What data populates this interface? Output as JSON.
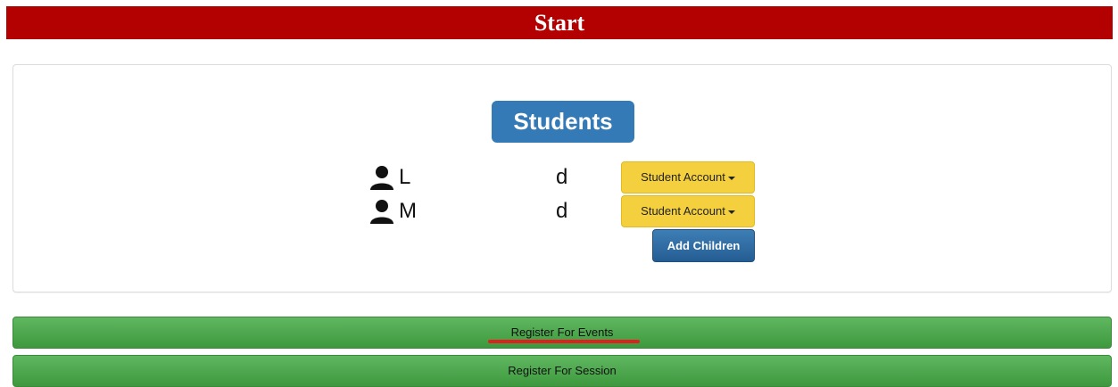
{
  "header": {
    "title": "Start"
  },
  "students_panel": {
    "title": "Students",
    "students": [
      {
        "name_visible_start": "L",
        "name_visible_end": "d",
        "account_label": "Student Account"
      },
      {
        "name_visible_start": "M",
        "name_visible_end": "d",
        "account_label": "Student Account"
      }
    ],
    "add_children_label": "Add Children"
  },
  "actions": {
    "register_events_label": "Register For Events",
    "register_session_label": "Register For Session"
  },
  "colors": {
    "header_bg": "#b30000",
    "badge_bg": "#337ab7",
    "account_btn": "#f4d03f",
    "green_btn": "#4cae4c",
    "annotation": "#e02020"
  },
  "icons": {
    "student_icon": "person-icon",
    "dropdown_icon": "caret-down-icon"
  }
}
